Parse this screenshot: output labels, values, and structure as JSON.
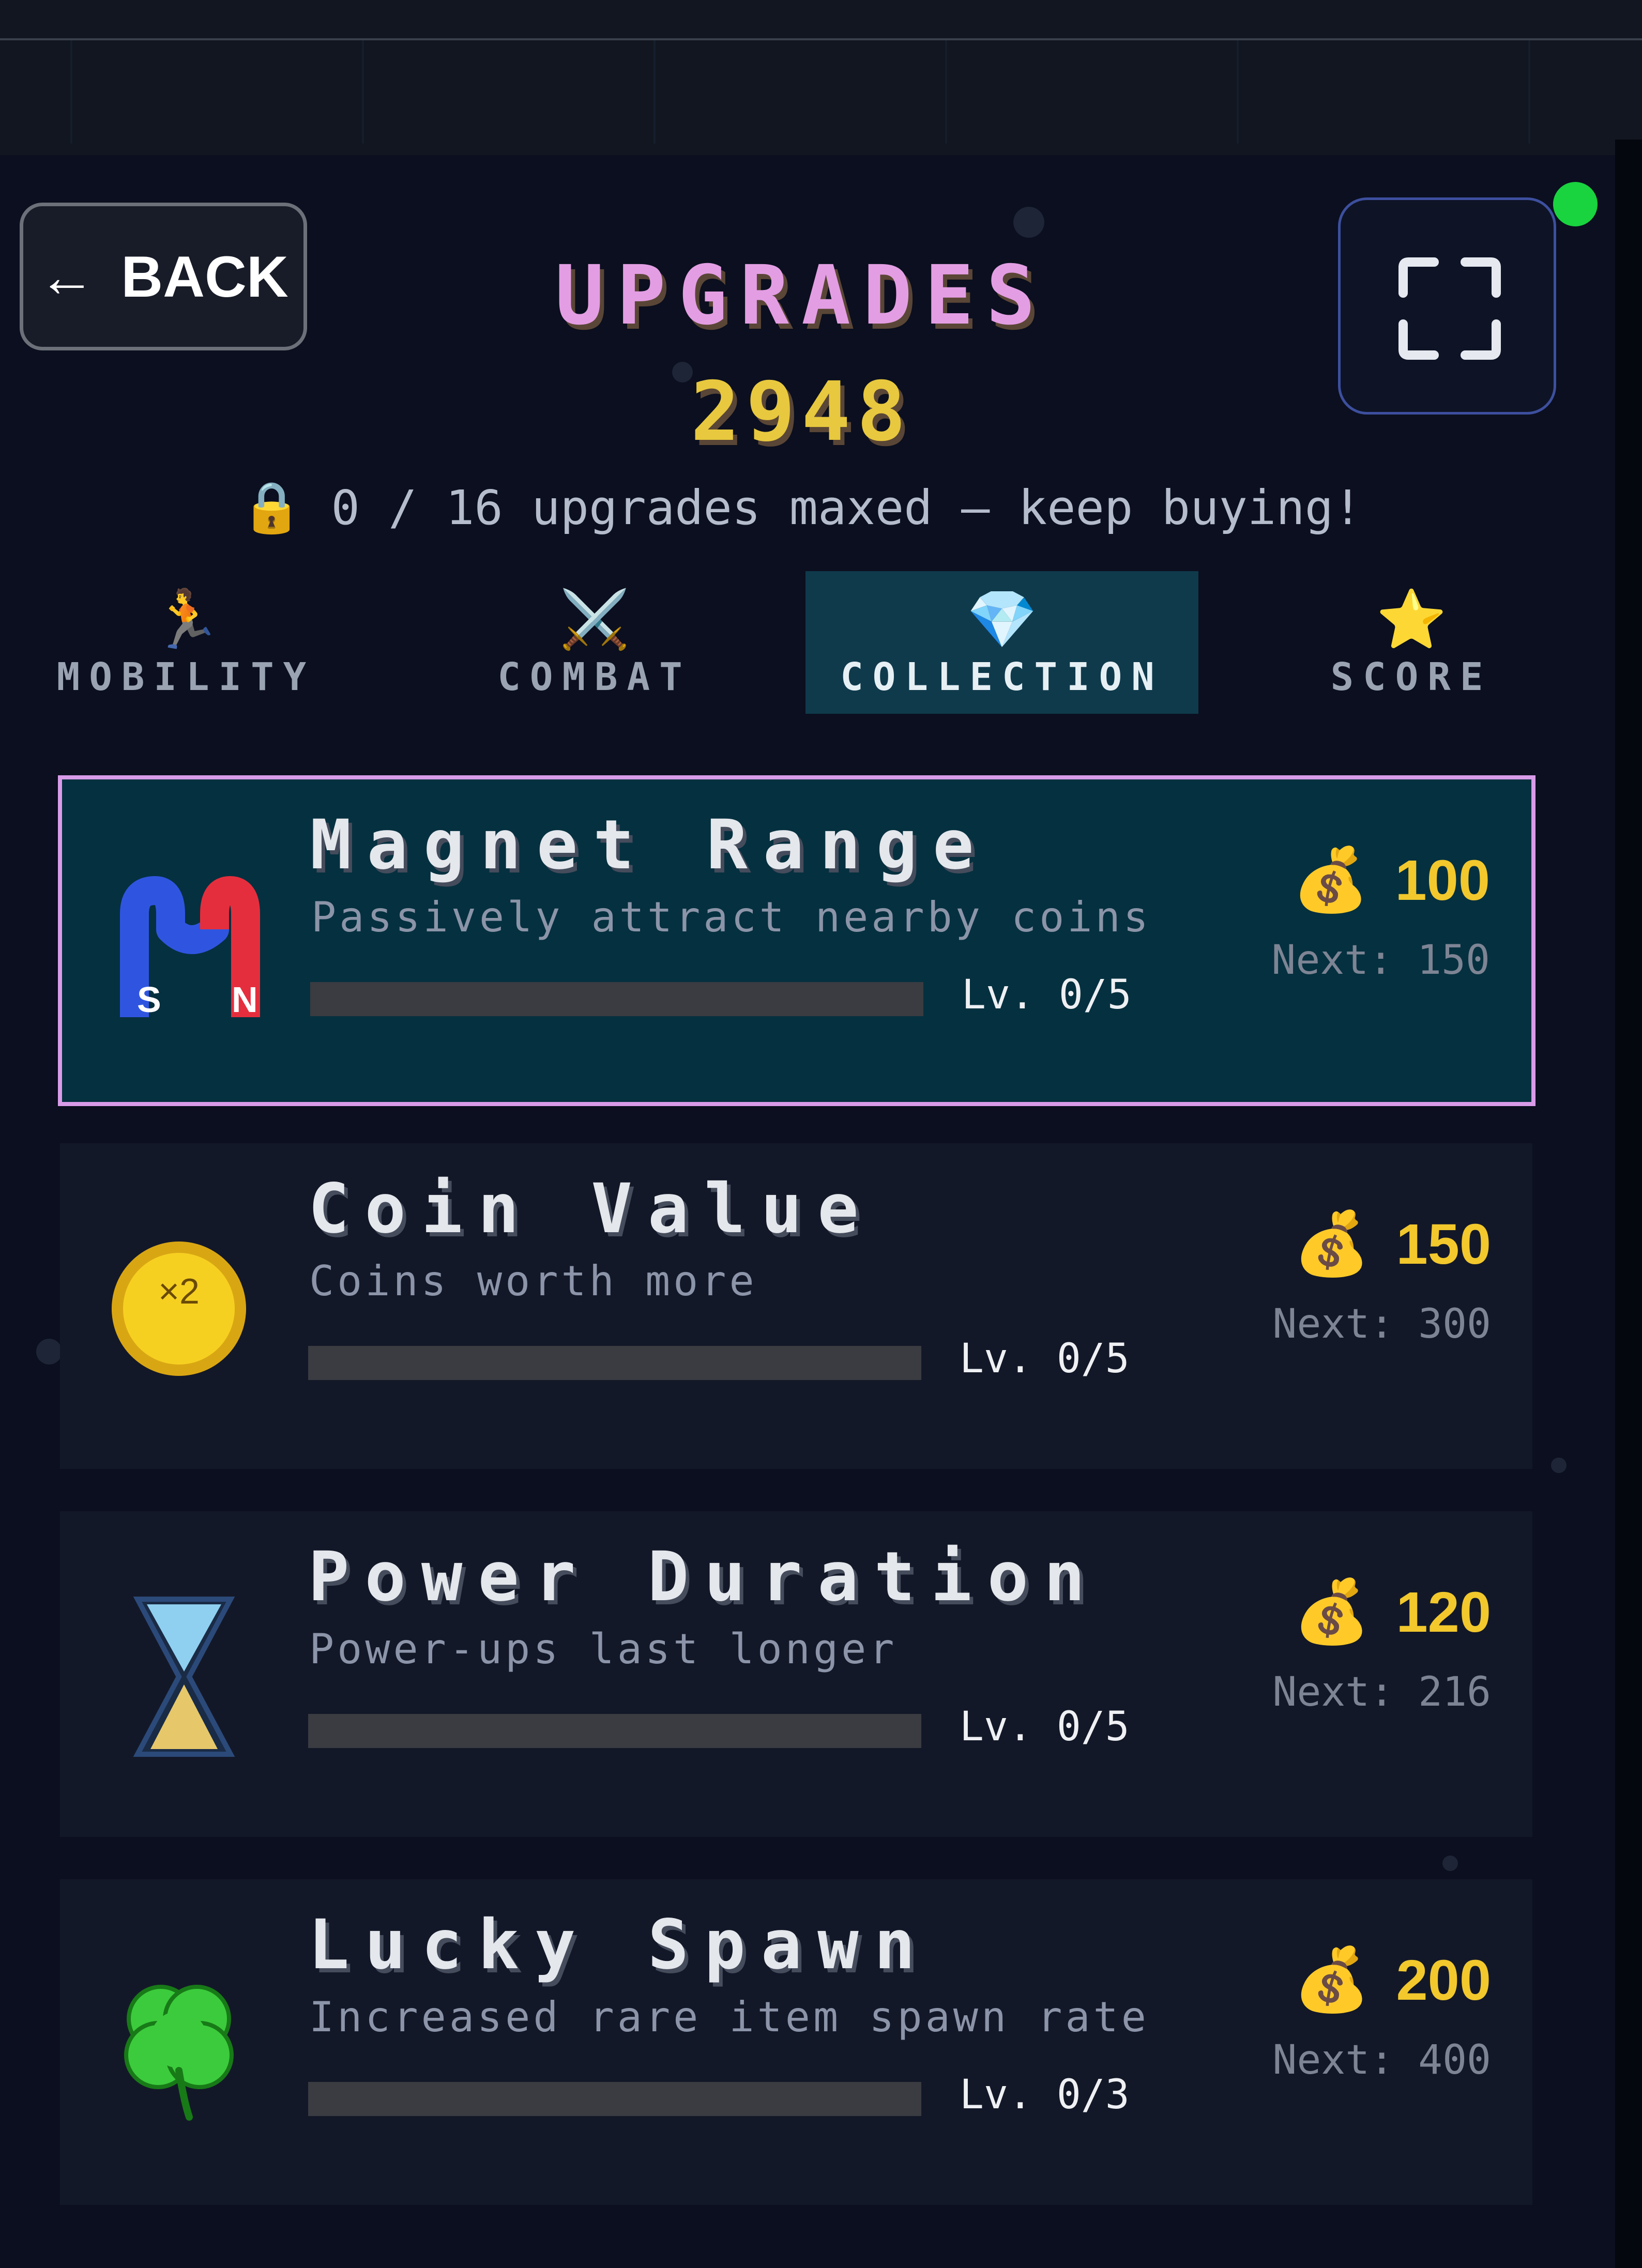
{
  "header": {
    "back_label": "BACK",
    "back_icon": "arrow-left-icon",
    "title": "UPGRADES",
    "coin_balance": "2948",
    "progress_text": "0 / 16 upgrades maxed — keep buying!",
    "progress_icon": "🔒",
    "fullscreen_icon": "fullscreen-icon",
    "status_color": "#19d33f"
  },
  "tabs": [
    {
      "icon": "🏃",
      "label": "MOBILITY",
      "active": false
    },
    {
      "icon": "⚔️",
      "label": "COMBAT",
      "active": false
    },
    {
      "icon": "💎",
      "label": "COLLECTION",
      "active": true
    },
    {
      "icon": "⭐",
      "label": "SCORE",
      "active": false
    }
  ],
  "upgrades": [
    {
      "icon": "magnet-icon",
      "name": "Magnet Range",
      "description": "Passively attract nearby coins",
      "level": "Lv. 0/5",
      "level_fraction": 0,
      "price_icon": "💰",
      "price": "100",
      "next": "Next: 150",
      "selected": true
    },
    {
      "icon": "coin-x2-icon",
      "icon_text": "×2",
      "name": "Coin Value",
      "description": "Coins worth more",
      "level": "Lv. 0/5",
      "level_fraction": 0,
      "price_icon": "💰",
      "price": "150",
      "next": "Next: 300",
      "selected": false
    },
    {
      "icon": "hourglass-icon",
      "name": "Power Duration",
      "description": "Power-ups last longer",
      "level": "Lv. 0/5",
      "level_fraction": 0,
      "price_icon": "💰",
      "price": "120",
      "next": "Next: 216",
      "selected": false
    },
    {
      "icon": "clover-icon",
      "name": "Lucky Spawn",
      "description": "Increased rare item spawn rate",
      "level": "Lv. 0/3",
      "level_fraction": 0,
      "price_icon": "💰",
      "price": "200",
      "next": "Next: 400",
      "selected": false
    }
  ],
  "colors": {
    "accent_pink": "#e39ee3",
    "coin_yellow": "#f2c82c",
    "selected_card_bg": "#05303f",
    "active_tab_bg": "#0f3a4c"
  }
}
